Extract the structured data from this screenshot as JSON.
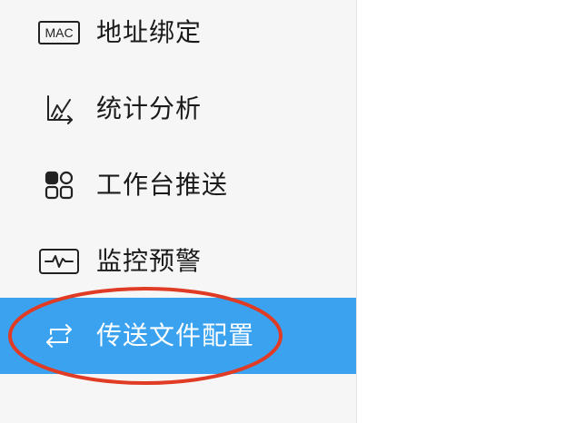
{
  "sidebar": {
    "items": [
      {
        "label": "地址绑定",
        "icon": "mac-icon",
        "icon_text": "MAC",
        "active": false
      },
      {
        "label": "统计分析",
        "icon": "line-chart-icon",
        "active": false
      },
      {
        "label": "工作台推送",
        "icon": "grid-apps-icon",
        "active": false
      },
      {
        "label": "监控预警",
        "icon": "pulse-monitor-icon",
        "active": false
      },
      {
        "label": "传送文件配置",
        "icon": "transfer-arrows-icon",
        "active": true
      }
    ]
  },
  "colors": {
    "active_background": "#3ba2ef",
    "annotation_circle": "#e03b24",
    "sidebar_background": "#f6f6f6"
  }
}
